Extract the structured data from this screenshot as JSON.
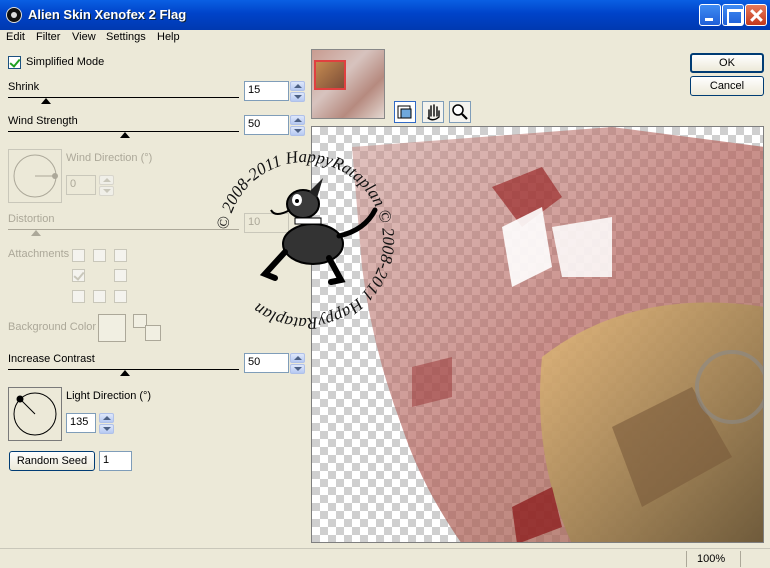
{
  "window": {
    "title": "Alien Skin Xenofex 2 Flag"
  },
  "menu": [
    "Edit",
    "Filter",
    "View",
    "Settings",
    "Help"
  ],
  "simplified_mode": {
    "label": "Simplified Mode",
    "checked": true
  },
  "shrink": {
    "label": "Shrink",
    "value": "15"
  },
  "wind_strength": {
    "label": "Wind Strength",
    "value": "50"
  },
  "wind_direction": {
    "label": "Wind Direction (°)",
    "value": "0"
  },
  "distortion": {
    "label": "Distortion",
    "value": "10"
  },
  "attachments": {
    "label": "Attachments"
  },
  "background_color": {
    "label": "Background Color"
  },
  "increase_contrast": {
    "label": "Increase Contrast",
    "value": "50"
  },
  "light_direction": {
    "label": "Light Direction (°)",
    "value": "135"
  },
  "random_seed": {
    "button_label": "Random Seed",
    "value": "1"
  },
  "buttons": {
    "ok": "OK",
    "cancel": "Cancel"
  },
  "watermark": {
    "text": "© 2008-2011 HappyRataplan © 2008-2011 HappyRataplan"
  },
  "status": {
    "zoom": "100%"
  },
  "icons": [
    "preview-toggle-icon",
    "hand-icon",
    "zoom-icon"
  ],
  "colors": {
    "title_bar": "#0a5fe3",
    "dialog_bg": "#ece9d8",
    "check_green": "#21a121",
    "flag_red": "#b9554f"
  }
}
